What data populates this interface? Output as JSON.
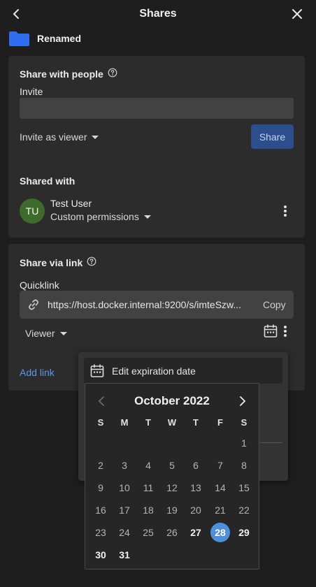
{
  "header": {
    "title": "Shares"
  },
  "resource": {
    "name": "Renamed",
    "icon": "folder-icon",
    "icon_color": "#2f6ef0"
  },
  "people": {
    "title": "Share with people",
    "invite_label": "Invite",
    "invite_value": "",
    "invite_placeholder": "",
    "role_dropdown": "Invite as viewer",
    "share_button": "Share",
    "shared_with_label": "Shared with",
    "collaborators": [
      {
        "initials": "TU",
        "name": "Test User",
        "permissions": "Custom permissions",
        "avatar_color": "#3f6b2a"
      }
    ]
  },
  "link": {
    "title": "Share via link",
    "quicklink_label": "Quicklink",
    "quicklink_url": "https://host.docker.internal:9200/s/imteSzw...",
    "copy_label": "Copy",
    "role_dropdown": "Viewer",
    "add_link": "Add link"
  },
  "menu": {
    "edit_expiration": "Edit expiration date"
  },
  "calendar": {
    "title": "October 2022",
    "weekdays": [
      "S",
      "M",
      "T",
      "W",
      "T",
      "F",
      "S"
    ],
    "selected_day": 28,
    "first_enabled_day": 27,
    "leading_blanks": 6,
    "days_in_month": 31
  },
  "colors": {
    "accent": "#4e8fdc",
    "share_button": "#2c4e8c",
    "link": "#5a9ae6",
    "panel": "#2c2c2c",
    "background": "#1e1e1e"
  }
}
